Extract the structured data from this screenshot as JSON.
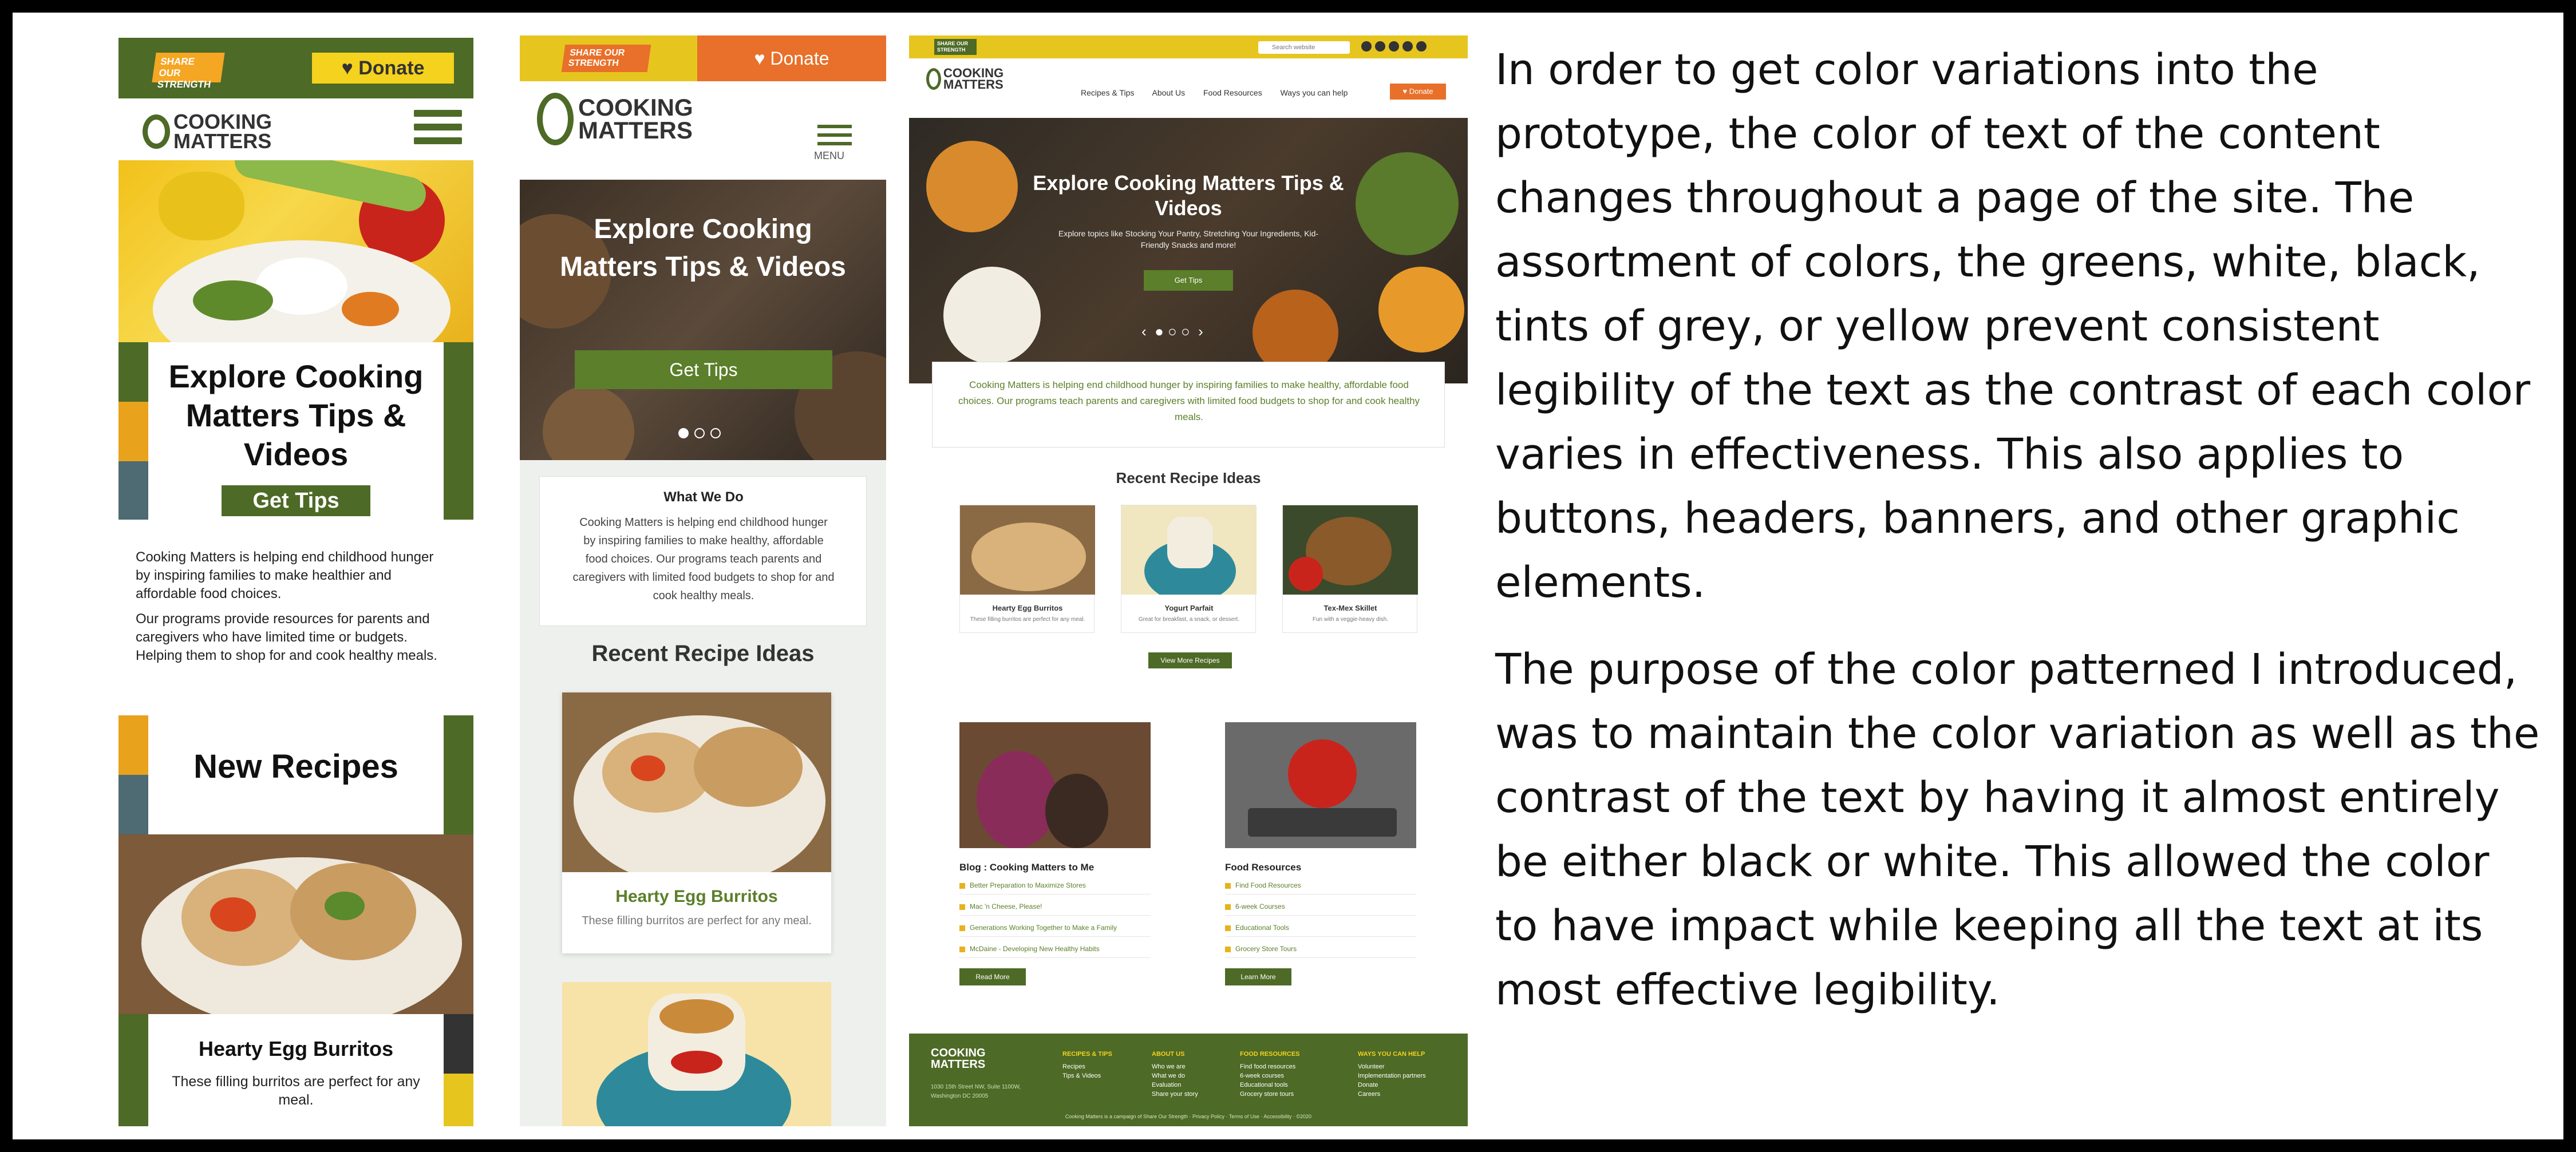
{
  "mobile_a": {
    "share_badge": "SHARE OUR STRENGTH",
    "donate_label": "Donate",
    "logo_text": "COOKING MATTERS",
    "hero_title": "Explore Cooking Matters Tips & Videos",
    "cta_label": "Get Tips",
    "intro_1": "Cooking Matters is helping end childhood hunger by inspiring families to make healthier and affordable food choices.",
    "intro_2": "Our programs provide resources for parents and caregivers who have limited time or budgets. Helping them to shop for and cook healthy meals.",
    "section_title": "New Recipes",
    "recipe_title": "Hearty Egg Burritos",
    "recipe_desc": "These filling burritos are perfect for any meal."
  },
  "mobile_b": {
    "share_badge": "SHARE OUR STRENGTH",
    "donate_label": "Donate",
    "logo_text": "COOKING MATTERS",
    "menu_label": "MENU",
    "hero_title": "Explore Cooking Matters Tips & Videos",
    "cta_label": "Get Tips",
    "what_we_do_title": "What We Do",
    "what_we_do_text": "Cooking Matters is helping end childhood hunger by inspiring families to make healthy, affordable food choices. Our programs teach parents and caregivers with limited food budgets to shop for and cook healthy meals.",
    "recipes_title": "Recent Recipe Ideas",
    "recipe_title": "Hearty Egg Burritos",
    "recipe_desc": "These filling burritos are perfect for any meal."
  },
  "desktop": {
    "share_badge": "SHARE OUR STRENGTH",
    "search_placeholder": "Search website",
    "logo_text": "COOKING MATTERS",
    "nav": [
      "Recipes & Tips",
      "About Us",
      "Food Resources",
      "Ways you can help"
    ],
    "donate_label": "Donate",
    "hero_title": "Explore Cooking Matters Tips & Videos",
    "hero_sub": "Explore topics like Stocking Your Pantry, Stretching Your Ingredients, Kid-Friendly Snacks and more!",
    "cta_label": "Get Tips",
    "intro": "Cooking Matters is helping end childhood hunger by inspiring families to make healthy, affordable food choices. Our programs teach parents and caregivers with limited food budgets to shop for and cook healthy meals.",
    "recipes_title": "Recent Recipe Ideas",
    "recipes": [
      {
        "title": "Hearty Egg Burritos",
        "desc": "These filling burritos are perfect for any meal."
      },
      {
        "title": "Yogurt Parfait",
        "desc": "Great for breakfast, a snack, or dessert."
      },
      {
        "title": "Tex-Mex Skillet",
        "desc": "Fun with a veggie-heavy dish."
      }
    ],
    "view_more_label": "View More Recipes",
    "blog": {
      "title": "Blog : Cooking Matters to Me",
      "links": [
        "Better Preparation to Maximize Stores",
        "Mac 'n Cheese, Please!",
        "Generations Working Together to Make a Family",
        "McDaine - Developing New Healthy Habits"
      ],
      "button": "Read More"
    },
    "resources": {
      "title": "Food Resources",
      "links": [
        "Find Food Resources",
        "6-week Courses",
        "Educational Tools",
        "Grocery Store Tours"
      ],
      "button": "Learn More"
    },
    "footer": {
      "logo_text": "COOKING MATTERS",
      "address": "1030 15th Street NW, Suite 1100W, Washington DC 20005",
      "cols": [
        {
          "head": "RECIPES & TIPS",
          "items": [
            "Recipes",
            "Tips & Videos"
          ]
        },
        {
          "head": "ABOUT US",
          "items": [
            "Who we are",
            "What we do",
            "Evaluation",
            "Share your story"
          ]
        },
        {
          "head": "FOOD RESOURCES",
          "items": [
            "Find food resources",
            "6-week courses",
            "Educational tools",
            "Grocery store tours"
          ]
        },
        {
          "head": "WAYS YOU CAN HELP",
          "items": [
            "Volunteer",
            "Implementation partners",
            "Donate",
            "Careers"
          ]
        }
      ],
      "copyright": "Cooking Matters is a campaign of Share Our Strength · Privacy Policy · Terms of Use · Accessibility · ©2020"
    }
  },
  "description": {
    "paragraph_1": "In order to get color variations into the prototype, the color of text of the content changes throughout a page of the site. The assortment of colors, the greens, white, black, tints of grey, or yellow prevent consistent legibility of the text as the contrast of each color varies in effectiveness. This also applies to buttons, headers, banners, and other graphic elements.",
    "paragraph_2": "The purpose of the color patterned I introduced, was to maintain the color variation as well as the contrast of the text by having it almost entirely be either black or white. This allowed the color to have impact while keeping all the text at its most effective legibility."
  },
  "colors": {
    "brand_green": "#4d6a26",
    "button_green": "#5b7f2a",
    "yellow": "#f4d21e",
    "orange": "#e8702a",
    "amber": "#e8a21c",
    "teal_gray": "#4e6a72"
  }
}
